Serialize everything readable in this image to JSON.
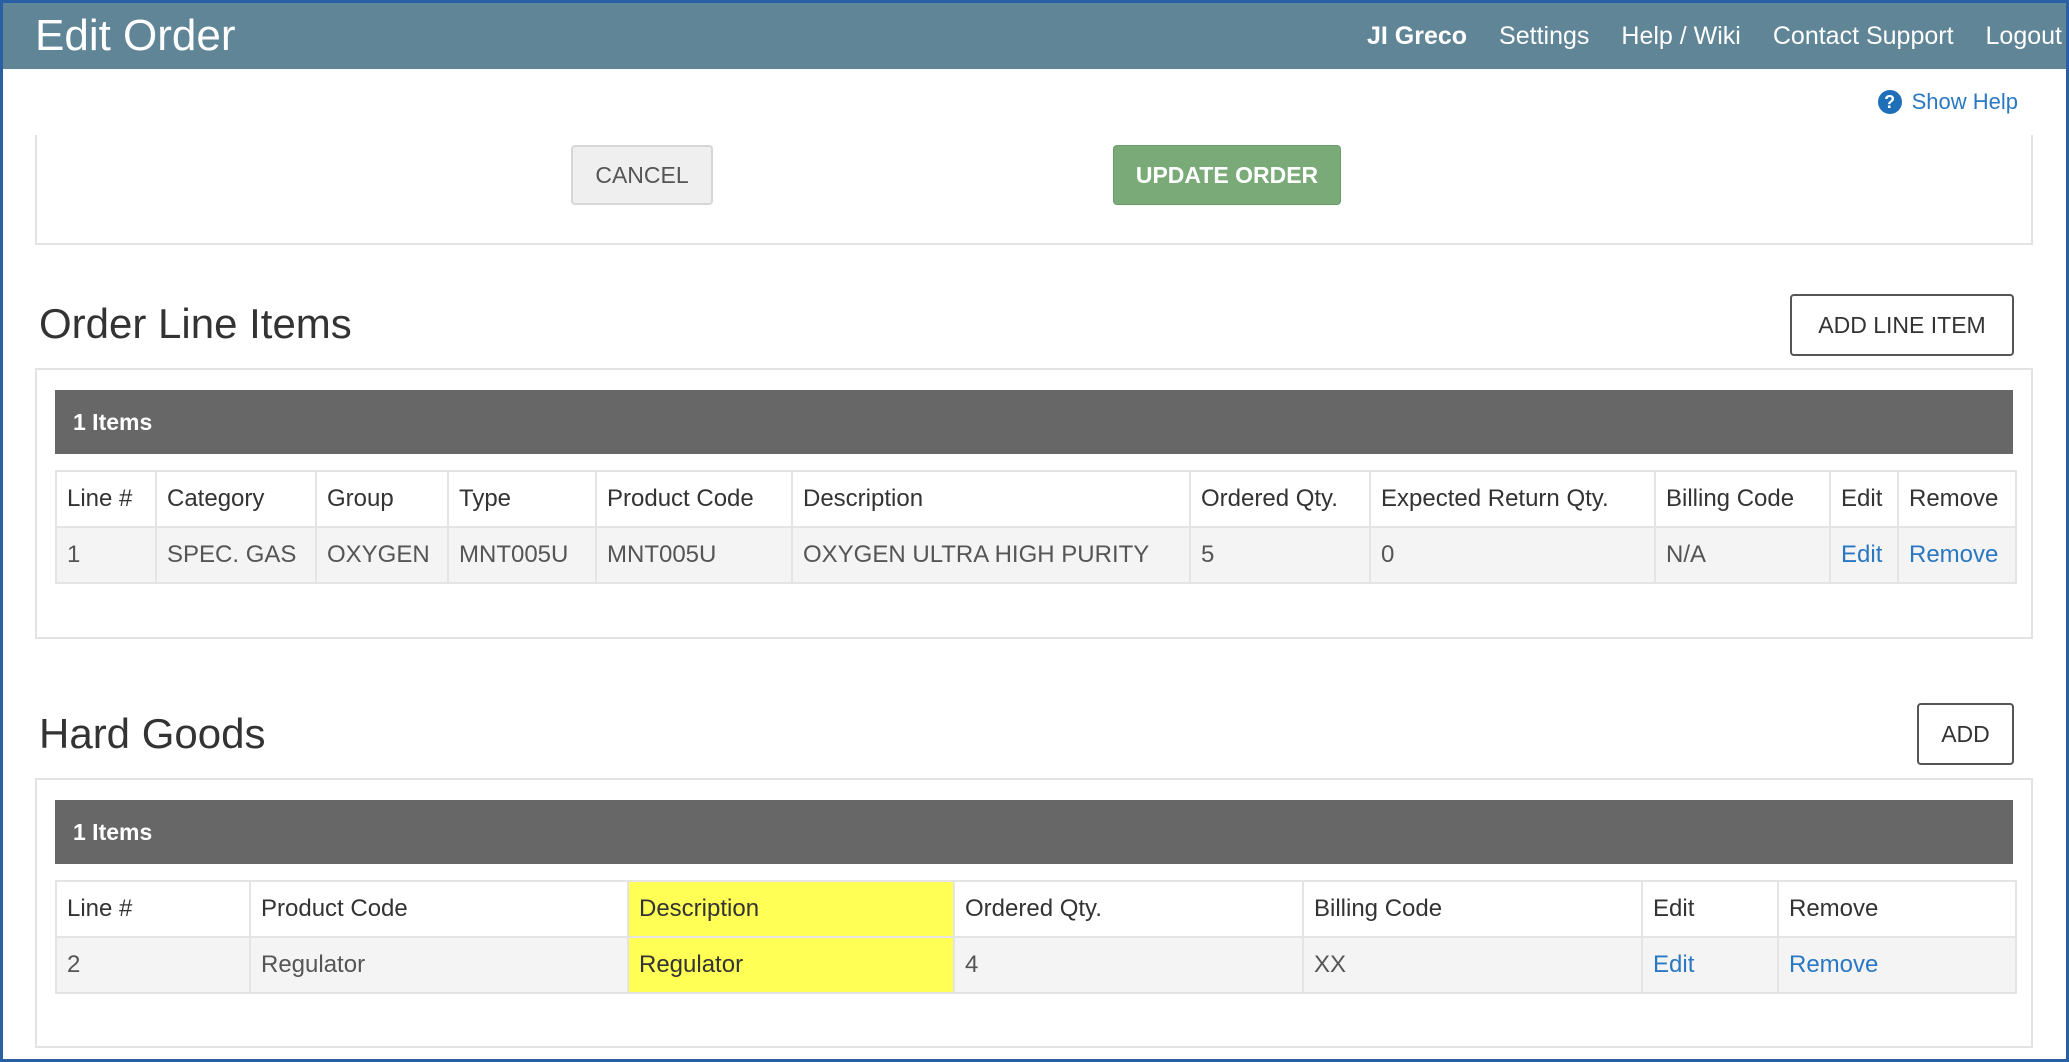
{
  "header": {
    "title": "Edit Order",
    "nav": {
      "user": "JI Greco",
      "settings": "Settings",
      "help": "Help / Wiki",
      "support": "Contact Support",
      "logout": "Logout"
    }
  },
  "help": {
    "icon": "question-circle-icon",
    "label": "Show Help"
  },
  "actions": {
    "cancel": "CANCEL",
    "update": "UPDATE ORDER"
  },
  "line_items": {
    "title": "Order Line Items",
    "add_label": "ADD LINE ITEM",
    "count_label": "1 Items",
    "columns": [
      "Line #",
      "Category",
      "Group",
      "Type",
      "Product Code",
      "Description",
      "Ordered Qty.",
      "Expected Return Qty.",
      "Billing Code",
      "Edit",
      "Remove"
    ],
    "rows": [
      {
        "line": "1",
        "category": "SPEC. GAS",
        "group": "OXYGEN",
        "type": "MNT005U",
        "product_code": "MNT005U",
        "description": "OXYGEN ULTRA HIGH PURITY",
        "ordered_qty": "5",
        "expected_return_qty": "0",
        "billing_code": "N/A",
        "edit": "Edit",
        "remove": "Remove"
      }
    ]
  },
  "hard_goods": {
    "title": "Hard Goods",
    "add_label": "ADD",
    "count_label": "1 Items",
    "columns": [
      "Line #",
      "Product Code",
      "Description",
      "Ordered Qty.",
      "Billing Code",
      "Edit",
      "Remove"
    ],
    "rows": [
      {
        "line": "2",
        "product_code": "Regulator",
        "description": "Regulator",
        "ordered_qty": "4",
        "billing_code": "XX",
        "edit": "Edit",
        "remove": "Remove"
      }
    ]
  },
  "colors": {
    "topbar": "#5f8596",
    "update_button": "#79aa78",
    "panel_header": "#676767",
    "link": "#2a78c2",
    "highlight": "#ffff55",
    "frame_border": "#2a5fa3"
  }
}
